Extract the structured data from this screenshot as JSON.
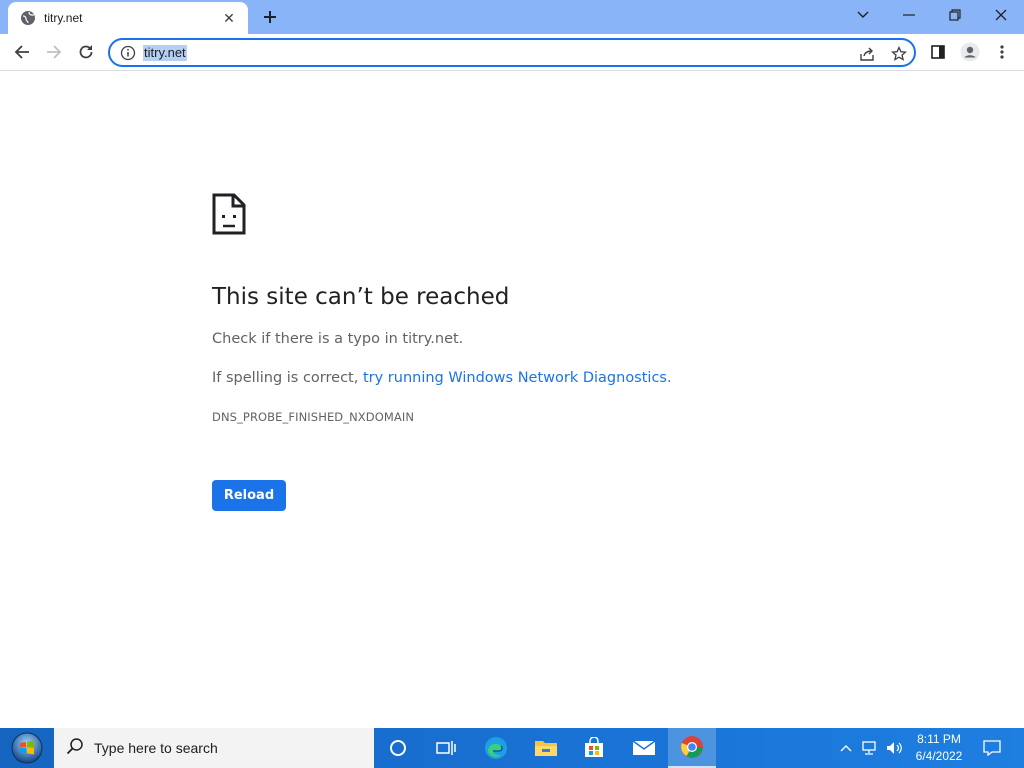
{
  "tab": {
    "title": "titry.net",
    "close_glyph": "✕"
  },
  "newtab_glyph": "+",
  "omnibox": {
    "url": "titry.net"
  },
  "error": {
    "title": "This site can’t be reached",
    "line1": "Check if there is a typo in titry.net.",
    "line2_prefix": "If spelling is correct, ",
    "line2_link": "try running Windows Network Diagnostics",
    "line2_suffix": ".",
    "code": "DNS_PROBE_FINISHED_NXDOMAIN",
    "reload_label": "Reload"
  },
  "taskbar": {
    "search_placeholder": "Type here to search",
    "time": "8:11 PM",
    "date": "6/4/2022"
  },
  "colors": {
    "accent": "#1a73e8",
    "tabstrip": "#8ab4f8",
    "taskbar": "#1a73d6"
  }
}
